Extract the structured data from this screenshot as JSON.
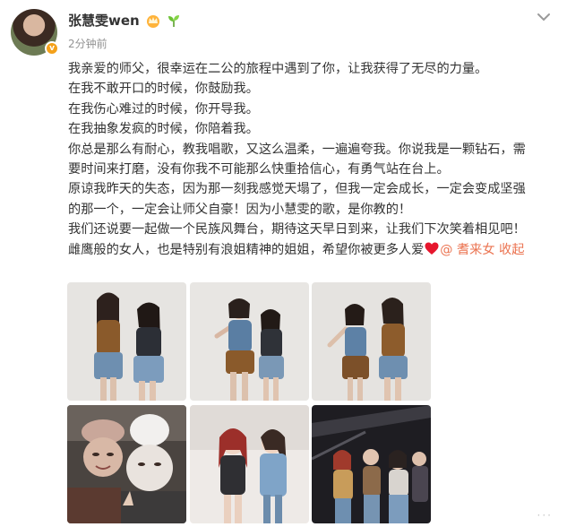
{
  "post": {
    "username": "张慧雯wen",
    "time": "2分钟前",
    "verified_icon": "v-badge-icon",
    "badges": [
      "crown-icon",
      "sprout-icon"
    ],
    "lines": [
      "我亲爱的师父，很幸运在二公的旅程中遇到了你，让我获得了无尽的力量。",
      "在我不敢开口的时候，你鼓励我。",
      "在我伤心难过的时候，你开导我。",
      "在我抽象发疯的时候，你陪着我。",
      "你总是那么有耐心，教我唱歌，又这么温柔，一遍遍夸我。你说我是一颗钻石，需",
      "要时间来打磨，没有你我不可能那么快重拾信心，有勇气站在台上。",
      "原谅我昨天的失态，因为那一刻我感觉天塌了，但我一定会成长，一定会变成坚强",
      "的那一个，一定会让师父自豪！因为小慧雯的歌，是你教的！",
      "我们还说要一起做一个民族风舞台，期待这天早日到来，让我们下次笑着相见吧！"
    ],
    "last_line_text": "雌鹰般的女人，也是特别有浪姐精神的姐姐，希望你被更多人爱",
    "mention": "@ 耆来女",
    "collapse_label": "收起",
    "more_label": "···"
  },
  "colors": {
    "accent": "#eb7350",
    "heart": "#e6162d",
    "time": "#939393",
    "text": "#333333"
  },
  "photos": [
    {
      "name": "photo-1"
    },
    {
      "name": "photo-2"
    },
    {
      "name": "photo-3"
    },
    {
      "name": "photo-4"
    },
    {
      "name": "photo-5"
    },
    {
      "name": "photo-6"
    }
  ]
}
